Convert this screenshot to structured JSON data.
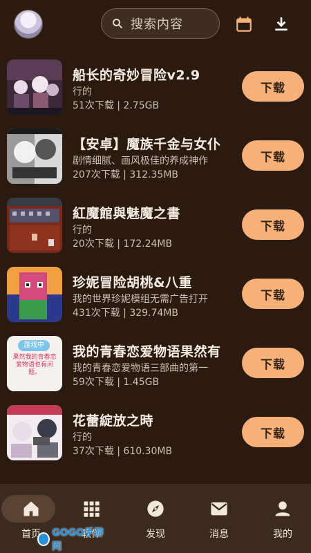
{
  "header": {
    "search_placeholder": "搜索内容",
    "avatar_icon": "avatar",
    "calendar_icon": "calendar-icon",
    "download_icon": "download-icon"
  },
  "items": [
    {
      "title": "船长的奇妙冒险v2.9",
      "subtitle": "行的",
      "meta": "51次下载 | 2.75GB",
      "button": "下载"
    },
    {
      "title": "【安卓】魔族千金与女仆",
      "subtitle": "剧情细腻、画风极佳的养成神作",
      "meta": "207次下载 | 312.35MB",
      "button": "下载"
    },
    {
      "title": "紅魔館與魅魔之書",
      "subtitle": "行的",
      "meta": "20次下载 | 172.24MB",
      "button": "下载"
    },
    {
      "title": "珍妮冒险胡桃&八重",
      "subtitle": "我的世界珍妮模组无需广告打开",
      "meta": "431次下载 | 329.74MB",
      "button": "下载"
    },
    {
      "title": "我的青春恋爱物语果然有",
      "subtitle": "我的青春恋爱物语三部曲的第一",
      "meta": "59次下载 | 1.45GB",
      "button": "下载"
    },
    {
      "title": "花蕾綻放之時",
      "subtitle": "行的",
      "meta": "37次下载 | 610.30MB",
      "button": "下载"
    }
  ],
  "thumb_texts": {
    "item5_badge": "游戏中",
    "item5_text": "果然我的青春恋爱物语也有问题。"
  },
  "nav": [
    {
      "label": "首页",
      "icon": "home-icon"
    },
    {
      "label": "软件",
      "icon": "grid-icon"
    },
    {
      "label": "发现",
      "icon": "compass-icon"
    },
    {
      "label": "消息",
      "icon": "mail-icon"
    },
    {
      "label": "我的",
      "icon": "person-icon"
    }
  ],
  "watermark": "GOGO手游网",
  "colors": {
    "background": "#2a1a10",
    "accent": "#f6b07a",
    "nav_bg": "#3a2a20"
  }
}
